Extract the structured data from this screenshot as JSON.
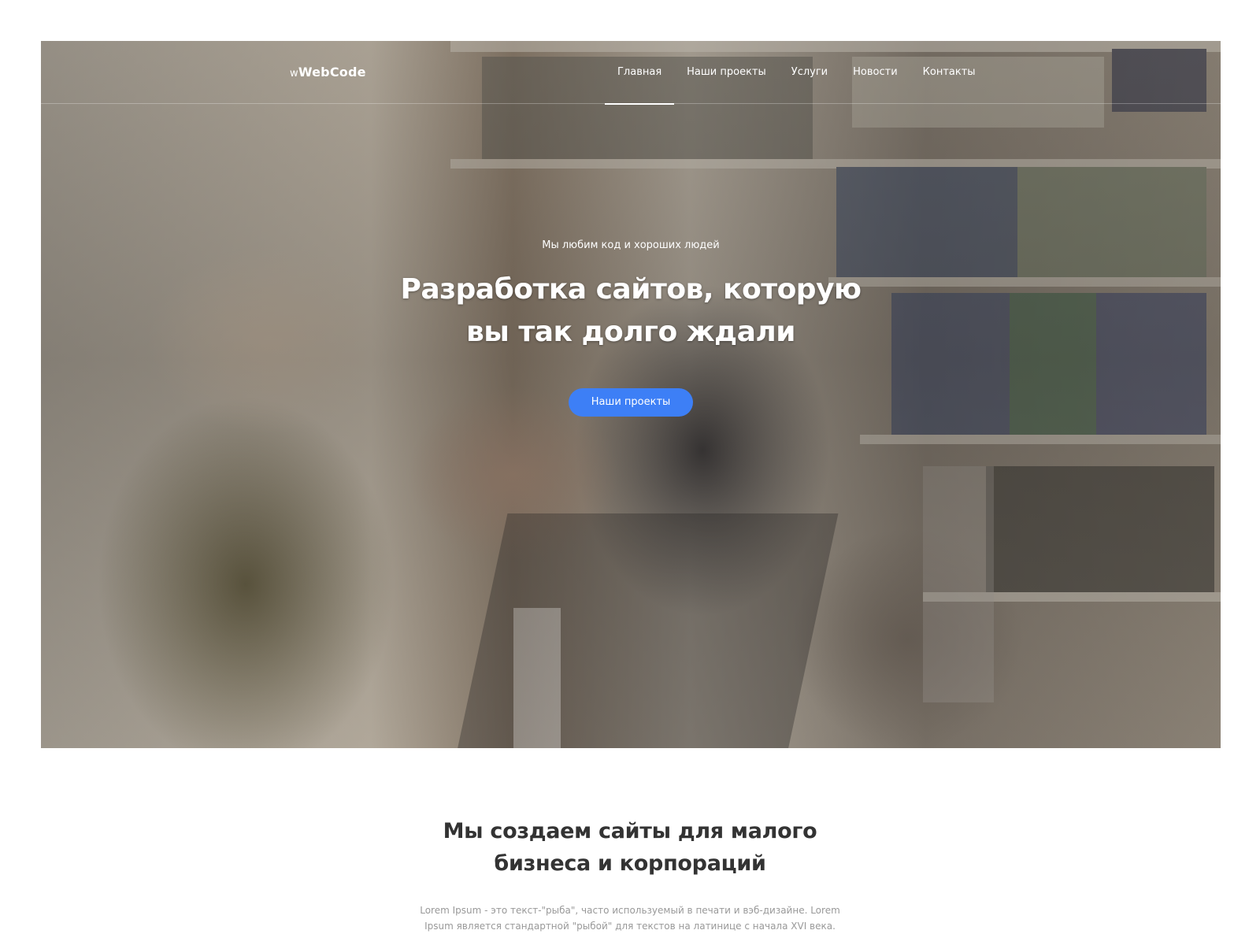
{
  "header": {
    "logo_prefix": "w",
    "logo_text": "WebCode",
    "menu": [
      {
        "label": "Главная",
        "active": true
      },
      {
        "label": "Наши проекты",
        "active": false
      },
      {
        "label": "Услуги",
        "active": false
      },
      {
        "label": "Новости",
        "active": false
      },
      {
        "label": "Контакты",
        "active": false
      }
    ]
  },
  "hero": {
    "subtitle": "Мы любим код и хороших людей",
    "title_line1": "Разработка сайтов, которую",
    "title_line2": "вы так долго ждали",
    "button_label": "Наши проекты",
    "image_icon": "team-photo"
  },
  "about": {
    "title_line1": "Мы создаем сайты для малого",
    "title_line2": "бизнеса и корпораций",
    "text": "Lorem Ipsum - это текст-\"рыба\", часто используемый в печати и вэб-дизайне. Lorem Ipsum является стандартной \"рыбой\" для текстов на латинице с начала XVI века."
  },
  "colors": {
    "accent": "#3d7ff6",
    "heading": "#333333",
    "muted_text": "#999999"
  }
}
